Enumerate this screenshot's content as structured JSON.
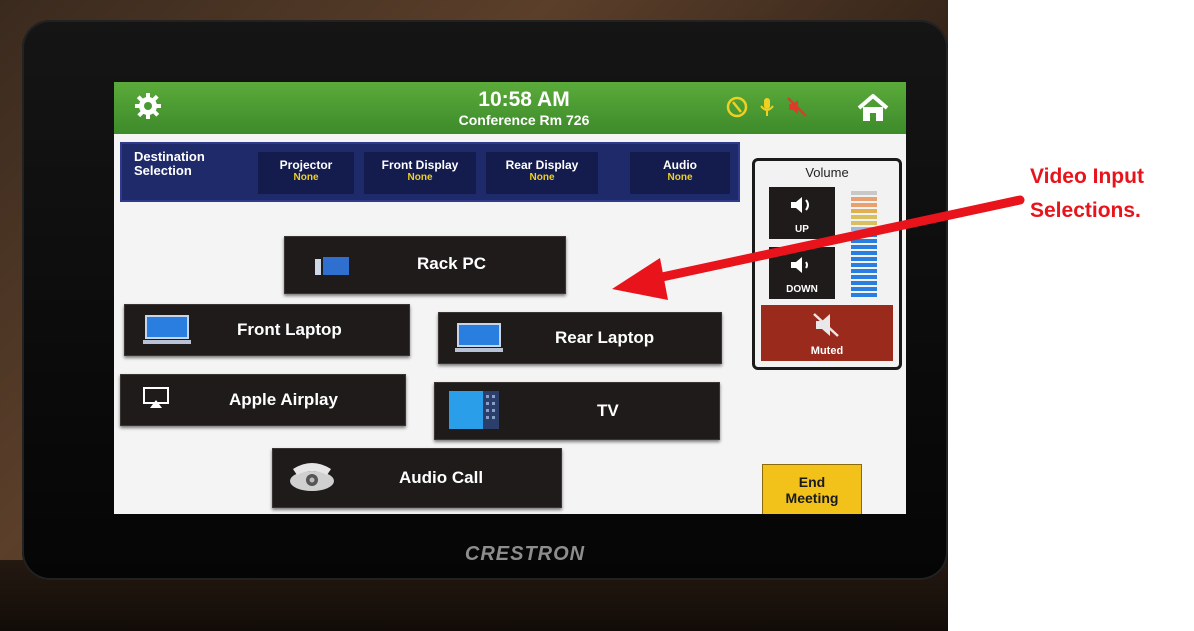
{
  "header": {
    "time": "10:58 AM",
    "room": "Conference Rm 726"
  },
  "destination": {
    "title_line1": "Destination",
    "title_line2": "Selection",
    "items": [
      {
        "label": "Projector",
        "value": "None"
      },
      {
        "label": "Front Display",
        "value": "None"
      },
      {
        "label": "Rear Display",
        "value": "None"
      },
      {
        "label": "Audio",
        "value": "None"
      }
    ]
  },
  "sources": [
    {
      "label": "Rack PC",
      "icon": "rack-pc-icon"
    },
    {
      "label": "Front Laptop",
      "icon": "laptop-icon"
    },
    {
      "label": "Rear Laptop",
      "icon": "laptop-icon"
    },
    {
      "label": "Apple Airplay",
      "icon": "airplay-icon"
    },
    {
      "label": "TV",
      "icon": "tv-icon"
    },
    {
      "label": "Audio Call",
      "icon": "phone-icon"
    }
  ],
  "volume": {
    "title": "Volume",
    "up_label": "UP",
    "down_label": "DOWN",
    "mute_label": "Muted"
  },
  "end_meeting": {
    "line1": "End",
    "line2": "Meeting"
  },
  "brand": "CRESTRON",
  "annotation": {
    "line1": "Video Input",
    "line2": "Selections.",
    "color": "#e8131b"
  },
  "colors": {
    "topbar": "#4a9a32",
    "destination_bar": "#1f2a6b",
    "source_button": "#1e1b1a",
    "muted": "#9a2a1c",
    "end_meeting": "#f2c21a",
    "dest_value": "#f0d020"
  }
}
